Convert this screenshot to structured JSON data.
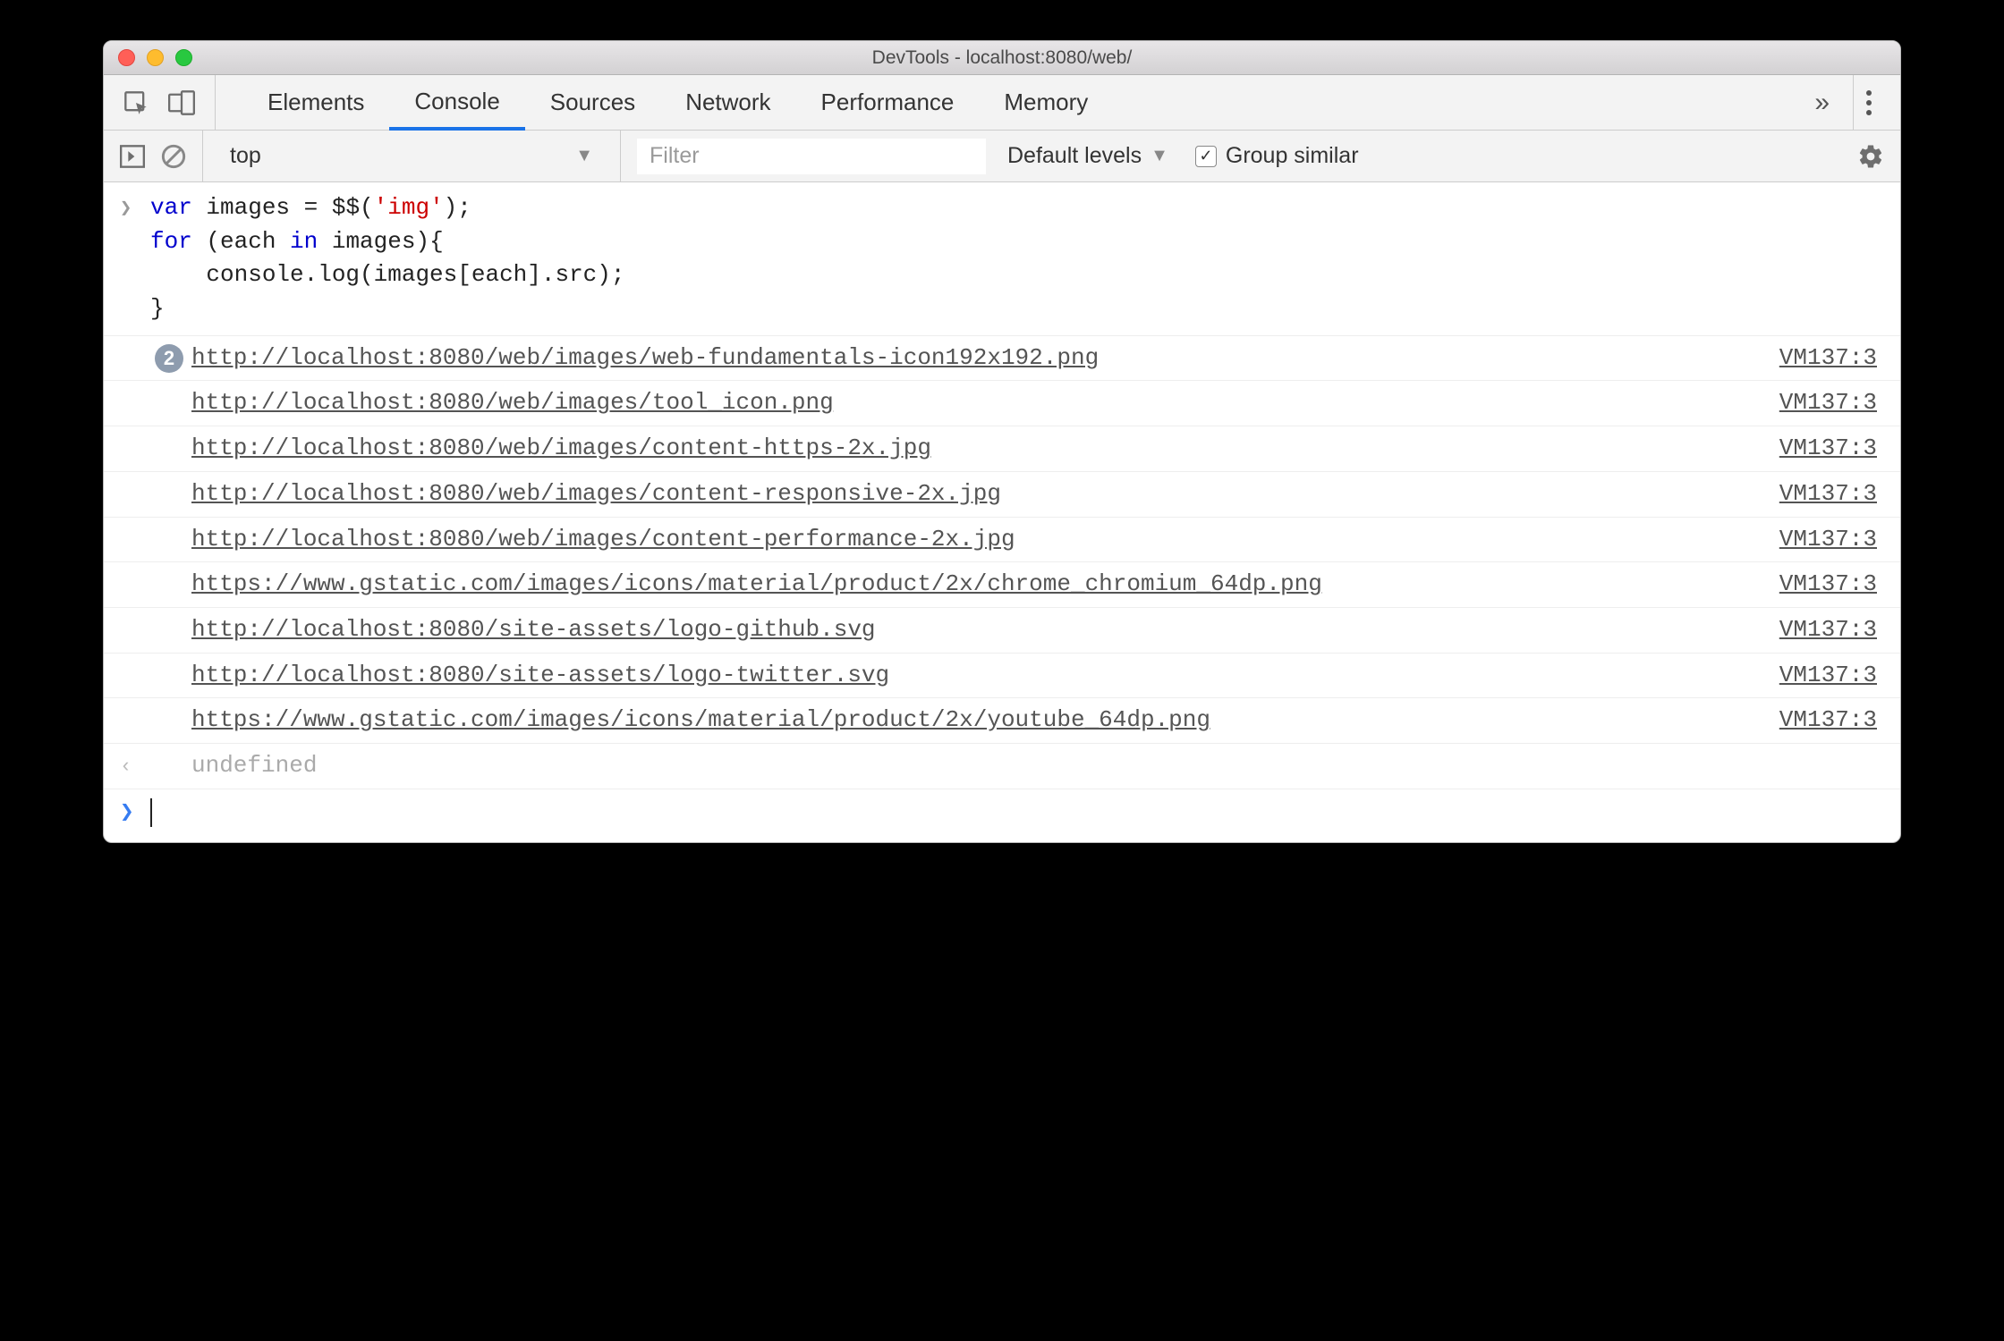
{
  "window": {
    "title": "DevTools - localhost:8080/web/"
  },
  "tabs": {
    "items": [
      "Elements",
      "Console",
      "Sources",
      "Network",
      "Performance",
      "Memory"
    ],
    "active_index": 1
  },
  "toolbar": {
    "context": "top",
    "filter_placeholder": "Filter",
    "levels_label": "Default levels",
    "group_similar_label": "Group similar",
    "group_similar_checked": true
  },
  "console": {
    "input_code": "var images = $$('img');\nfor (each in images){\n    console.log(images[each].src);\n}",
    "messages": [
      {
        "repeat": 2,
        "text": "http://localhost:8080/web/images/web-fundamentals-icon192x192.png",
        "source": "VM137:3"
      },
      {
        "repeat": null,
        "text": "http://localhost:8080/web/images/tool_icon.png",
        "source": "VM137:3"
      },
      {
        "repeat": null,
        "text": "http://localhost:8080/web/images/content-https-2x.jpg",
        "source": "VM137:3"
      },
      {
        "repeat": null,
        "text": "http://localhost:8080/web/images/content-responsive-2x.jpg",
        "source": "VM137:3"
      },
      {
        "repeat": null,
        "text": "http://localhost:8080/web/images/content-performance-2x.jpg",
        "source": "VM137:3"
      },
      {
        "repeat": null,
        "text": "https://www.gstatic.com/images/icons/material/product/2x/chrome_chromium_64dp.png",
        "source": "VM137:3"
      },
      {
        "repeat": null,
        "text": "http://localhost:8080/site-assets/logo-github.svg",
        "source": "VM137:3"
      },
      {
        "repeat": null,
        "text": "http://localhost:8080/site-assets/logo-twitter.svg",
        "source": "VM137:3"
      },
      {
        "repeat": null,
        "text": "https://www.gstatic.com/images/icons/material/product/2x/youtube_64dp.png",
        "source": "VM137:3"
      }
    ],
    "return_value": "undefined"
  }
}
